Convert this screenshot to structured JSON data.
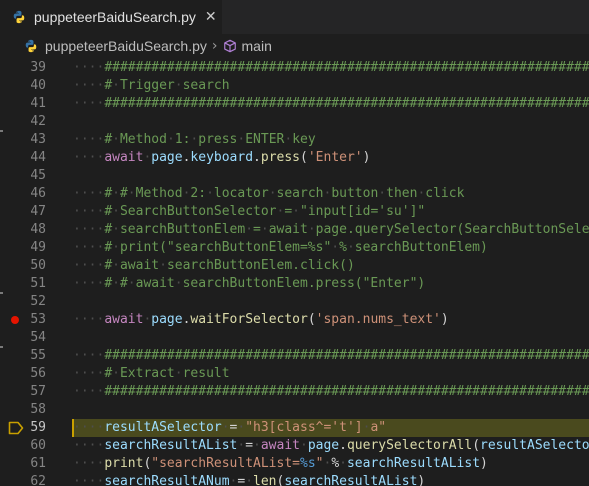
{
  "tab": {
    "title": "puppeteerBaiduSearch.py",
    "close_glyph": "✕",
    "icon": "python-icon"
  },
  "breadcrumb": {
    "file": "puppeteerBaiduSearch.py",
    "separator": "›",
    "symbol": "main",
    "symbol_icon": "cube-icon"
  },
  "editor": {
    "breakpoint_line": "53",
    "current_line": "59",
    "colors": {
      "breakpoint": "#e51400",
      "current_line_arrow": "#c9a000",
      "comment": "#6a9955",
      "string": "#ce9178",
      "keyword": "#c586c0",
      "variable": "#9cdcfe",
      "function": "#dcdcaa"
    },
    "lines": [
      {
        "num": "39",
        "code": "    ###############################################################"
      },
      {
        "num": "40",
        "code": "    # Trigger search"
      },
      {
        "num": "41",
        "code": "    ###############################################################"
      },
      {
        "num": "42",
        "code": ""
      },
      {
        "num": "43",
        "code": "    # Method 1: press ENTER key"
      },
      {
        "num": "44",
        "code": "    await page.keyboard.press('Enter')"
      },
      {
        "num": "45",
        "code": ""
      },
      {
        "num": "46",
        "code": "    # # Method 2: locator search button then click"
      },
      {
        "num": "47",
        "code": "    # SearchButtonSelector = \"input[id='su']\""
      },
      {
        "num": "48",
        "code": "    # searchButtonElem = await page.querySelector(SearchButtonSelector)"
      },
      {
        "num": "49",
        "code": "    # print(\"searchButtonElem=%s\" % searchButtonElem)"
      },
      {
        "num": "50",
        "code": "    # await searchButtonElem.click()"
      },
      {
        "num": "51",
        "code": "    # # await searchButtonElem.press(\"Enter\")"
      },
      {
        "num": "52",
        "code": ""
      },
      {
        "num": "53",
        "code": "    await page.waitForSelector('span.nums_text')"
      },
      {
        "num": "54",
        "code": ""
      },
      {
        "num": "55",
        "code": "    ###############################################################"
      },
      {
        "num": "56",
        "code": "    # Extract result"
      },
      {
        "num": "57",
        "code": "    ###############################################################"
      },
      {
        "num": "58",
        "code": ""
      },
      {
        "num": "59",
        "code": "    resultASelector = \"h3[class^='t'] a\""
      },
      {
        "num": "60",
        "code": "    searchResultAList = await page.querySelectorAll(resultASelector)"
      },
      {
        "num": "61",
        "code": "    print(\"searchResultAList=%s\" % searchResultAList)"
      },
      {
        "num": "62",
        "code": "    searchResultANum = len(searchResultAList)"
      }
    ]
  }
}
